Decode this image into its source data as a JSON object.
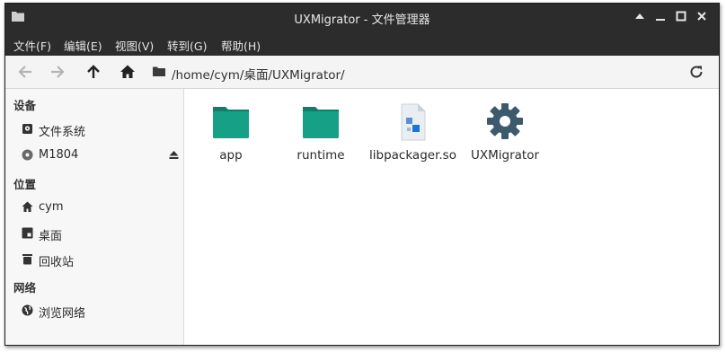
{
  "window": {
    "title": "UXMigrator - 文件管理器"
  },
  "menu": {
    "items": [
      "文件(F)",
      "编辑(E)",
      "视图(V)",
      "转到(G)",
      "帮助(H)"
    ]
  },
  "toolbar": {
    "path": "/home/cym/桌面/UXMigrator/"
  },
  "sidebar": {
    "devices_header": "设备",
    "places_header": "位置",
    "network_header": "网络",
    "devices": [
      {
        "label": "文件系统",
        "icon": "drive-icon"
      },
      {
        "label": "M1804",
        "icon": "disc-icon"
      }
    ],
    "places": [
      {
        "label": "cym",
        "icon": "home-icon"
      },
      {
        "label": "桌面",
        "icon": "desktop-icon"
      },
      {
        "label": "回收站",
        "icon": "trash-icon"
      }
    ],
    "network": [
      {
        "label": "浏览网络",
        "icon": "globe-icon"
      }
    ]
  },
  "files": [
    {
      "name": "app",
      "icon": "folder-icon"
    },
    {
      "name": "runtime",
      "icon": "folder-icon"
    },
    {
      "name": "libpackager.so",
      "icon": "shared-library-icon"
    },
    {
      "name": "UXMigrator",
      "icon": "executable-gear-icon"
    }
  ],
  "colors": {
    "titlebar": "#2c2c2c",
    "folder": "#16a085",
    "gear": "#3d5a6c",
    "lib_blue": "#1e73d6"
  }
}
